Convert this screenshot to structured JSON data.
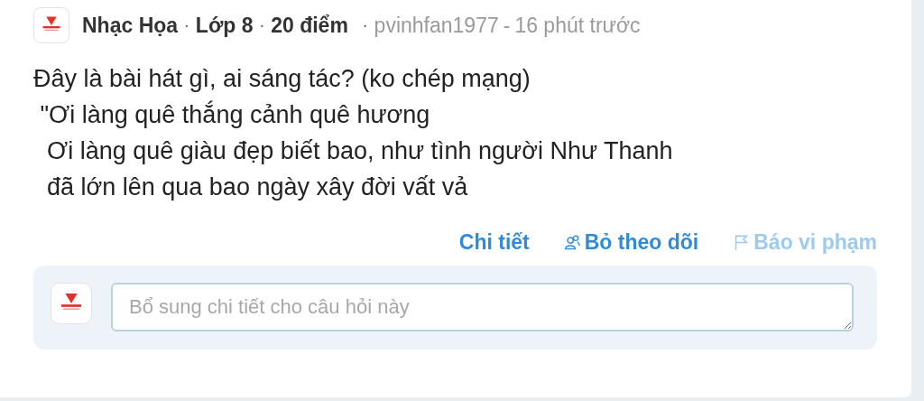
{
  "question": {
    "subject": "Nhạc Họa",
    "grade": "Lớp 8",
    "points": "20 điểm",
    "author": "pvinhfan1977",
    "time": "16 phút trước",
    "separators": [
      "·",
      "·",
      "·"
    ],
    "dash": "-",
    "body": "Đây là bài hát gì, ai sáng tác? (ko chép mạng)\n \"Ơi làng quê thắng cảnh quê hương\n  Ơi làng quê giàu đẹp biết bao, như tình người Như Thanh\n  đã lớn lên qua bao ngày xây đời vất vả"
  },
  "actions": [
    {
      "label": "Chi tiết",
      "kind": "plain",
      "color": "#2f8ad8"
    },
    {
      "label": "Bỏ theo dõi",
      "kind": "follow",
      "color": "#2f8ad8"
    },
    {
      "label": "Báo vi phạm",
      "kind": "flag",
      "color": "#9ccaf0"
    }
  ],
  "comment": {
    "placeholder": "Bổ sung chi tiết cho câu hỏi này"
  }
}
